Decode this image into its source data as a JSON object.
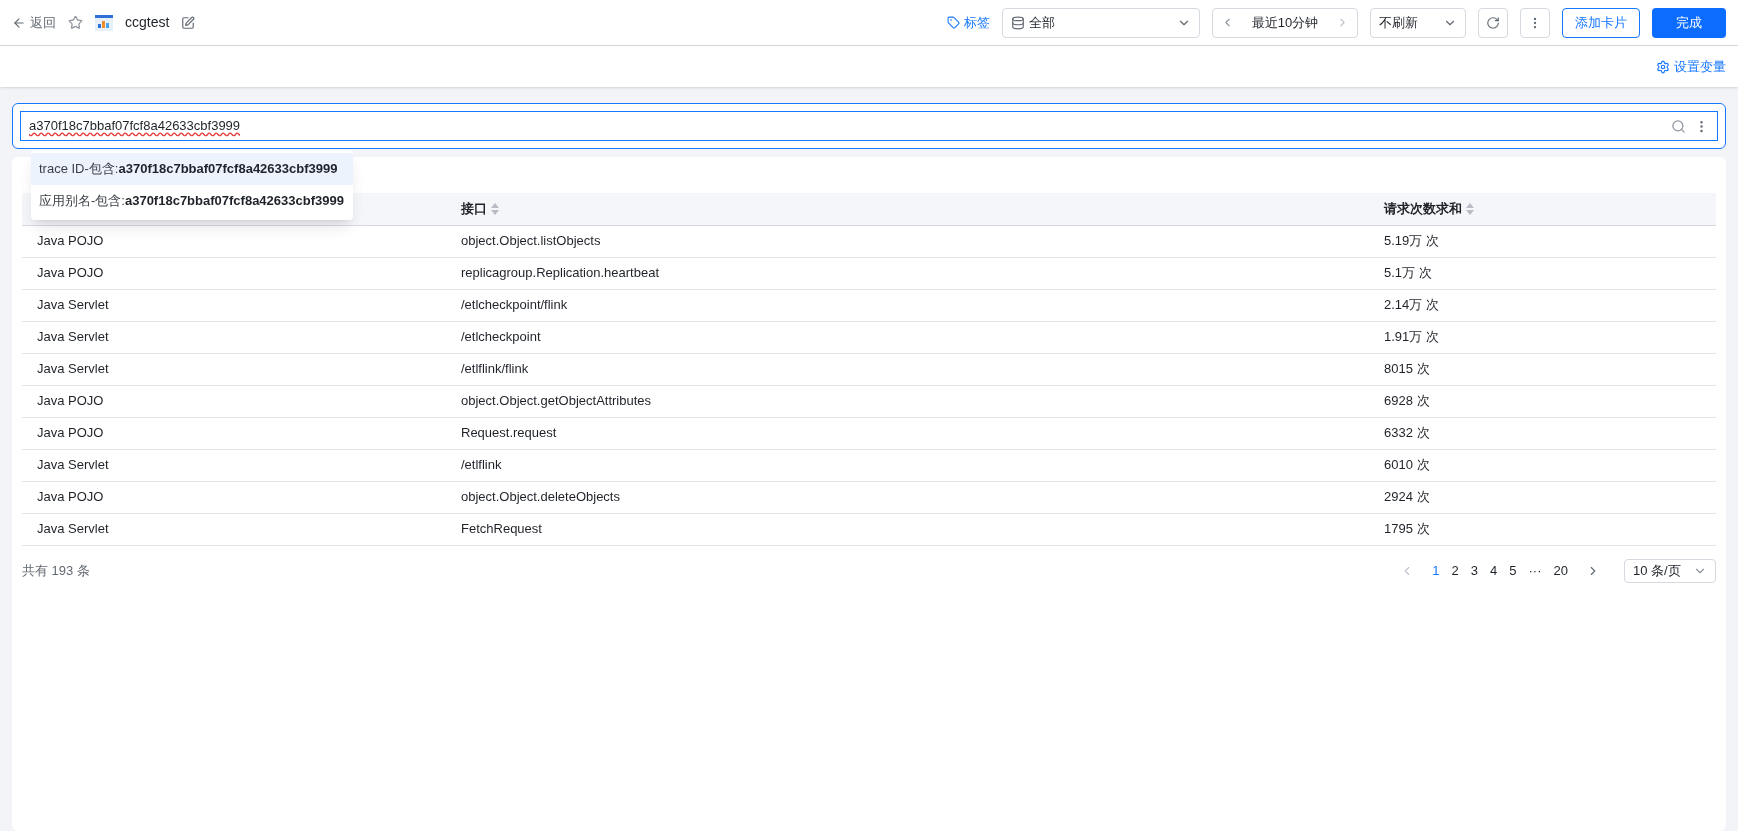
{
  "header": {
    "back": "返回",
    "starred": false,
    "title": "ccgtest",
    "tag_link": "标签",
    "scope_select": "全部",
    "time_range": "最近10分钟",
    "refresh_select": "不刷新",
    "add_card": "添加卡片",
    "done": "完成"
  },
  "subbar": {
    "set_variables": "设置变量"
  },
  "search": {
    "value": "a370f18c7bbaf07fcf8a42633cbf3999"
  },
  "suggestions": [
    {
      "prefix": "trace ID-包含:",
      "value": "a370f18c7bbaf07fcf8a42633cbf3999",
      "selected": true
    },
    {
      "prefix": "应用别名-包含:",
      "value": "a370f18c7bbaf07fcf8a42633cbf3999",
      "selected": false
    }
  ],
  "table": {
    "columns": [
      "",
      "接口",
      "请求次数求和"
    ],
    "rows": [
      [
        "Java POJO",
        "object.Object.listObjects",
        "5.19万 次"
      ],
      [
        "Java POJO",
        "replicagroup.Replication.heartbeat",
        "5.1万 次"
      ],
      [
        "Java Servlet",
        "/etlcheckpoint/flink",
        "2.14万 次"
      ],
      [
        "Java Servlet",
        "/etlcheckpoint",
        "1.91万 次"
      ],
      [
        "Java Servlet",
        "/etlflink/flink",
        "8015 次"
      ],
      [
        "Java POJO",
        "object.Object.getObjectAttributes",
        "6928 次"
      ],
      [
        "Java POJO",
        "Request.request",
        "6332 次"
      ],
      [
        "Java Servlet",
        "/etlflink",
        "6010 次"
      ],
      [
        "Java POJO",
        "object.Object.deleteObjects",
        "2924 次"
      ],
      [
        "Java Servlet",
        "FetchRequest",
        "1795 次"
      ]
    ]
  },
  "footer": {
    "total": "共有 193 条",
    "pages": [
      {
        "label": "1",
        "selected": true
      },
      {
        "label": "2",
        "selected": false
      },
      {
        "label": "3",
        "selected": false
      },
      {
        "label": "4",
        "selected": false
      },
      {
        "label": "5",
        "selected": false
      },
      {
        "label": "···",
        "selected": false
      },
      {
        "label": "20",
        "selected": false
      }
    ],
    "page_size": "10 条/页"
  }
}
